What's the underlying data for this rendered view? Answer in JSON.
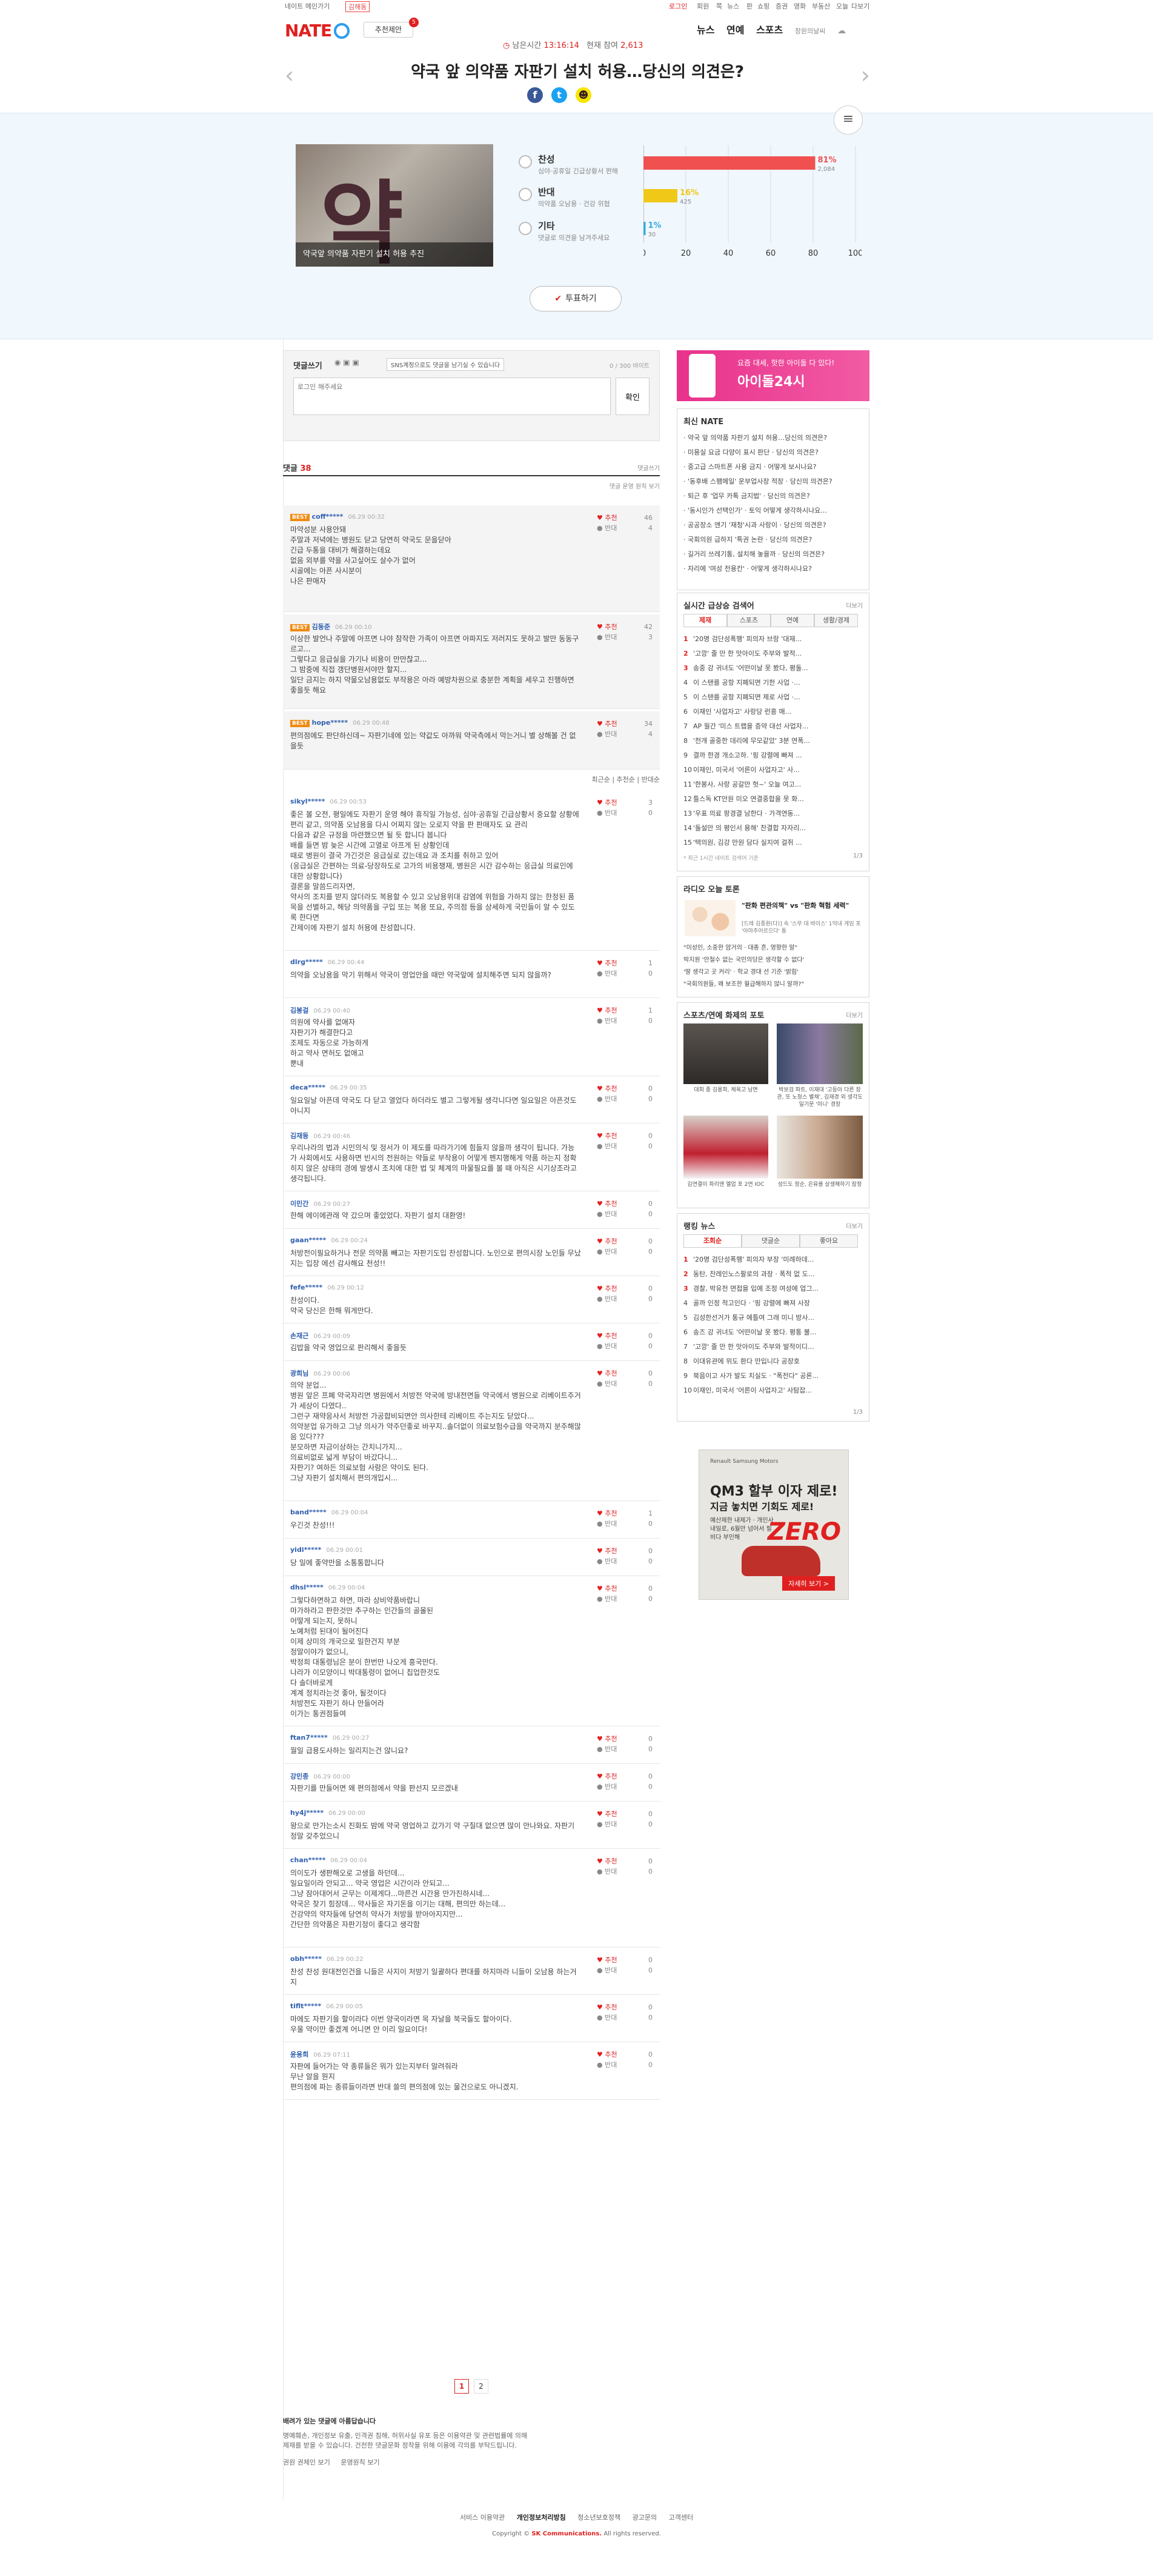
{
  "gnb": {
    "left_link": "네이트 메인가기",
    "left_tab": "김해동",
    "right_links": [
      "로그인",
      "회원",
      "쪽",
      "뉴스",
      "판",
      "쇼핑",
      "증권",
      "영화",
      "부동산",
      "오늘",
      "다보기"
    ]
  },
  "header": {
    "logo": "NATE",
    "subscribe_label": "추천제안",
    "subscribe_badge": "5",
    "status_label": "남은시간",
    "remaining_time": "13:16:14",
    "participants_label": "현재 참여",
    "participants": "2,613",
    "nav": [
      "뉴스",
      "연예",
      "스포츠"
    ],
    "weather": "창원의날씨",
    "title": "약국 앞 의약품 자판기 설치 허용…당신의 의견은?"
  },
  "share": {
    "icons": [
      "facebook-icon",
      "twitter-icon",
      "kakao-icon"
    ]
  },
  "vote": {
    "image_caption": "약국앞 의약품 자판기 설치 허용 추진",
    "image_glyph": "약",
    "options": [
      {
        "label": "찬성",
        "desc": "심야·공휴일 긴급상황서 편해"
      },
      {
        "label": "반대",
        "desc": "의약품 오남용 · 건강 위협"
      },
      {
        "label": "기타",
        "desc": "댓글로 의견을 남겨주세요"
      }
    ],
    "button_label": "투표하기"
  },
  "chart_data": {
    "type": "bar",
    "orientation": "horizontal",
    "categories": [
      "찬성",
      "반대",
      "기타"
    ],
    "values": [
      81,
      16,
      1
    ],
    "counts": [
      "2,084",
      "425",
      "30"
    ],
    "bar_labels": [
      "81%",
      "16%",
      "1%"
    ],
    "colors": [
      "#f05050",
      "#f0c818",
      "#3aa8e0"
    ],
    "xlim": [
      0,
      100
    ],
    "xticks": [
      "0",
      "20",
      "40",
      "60",
      "80",
      "100"
    ]
  },
  "comment_box": {
    "title": "댓글쓰기",
    "notice": "SNS계정으로도 댓글을 남기실 수 있습니다",
    "char_count": "0 / 300 바이트",
    "placeholder": "로그인 해주세요",
    "submit": "확인"
  },
  "comments_header": {
    "label": "댓글",
    "count": "38",
    "right": "댓글쓰기",
    "sort_note": "댓글 운영 원칙 보기"
  },
  "best_comments": [
    {
      "tag": "BEST",
      "user": "coff*****",
      "date": "06.29 00:32",
      "text": "마약성분 사용안돼\n주말과 저녁에는 병원도 닫고 당연히 약국도 문을닫아\n긴급 두통을 대비가 해결하는데요\n없음 외부를 약을 사고싶어도 살수가 없어\n시골에는 아픈 사시분이\n나은 판매자\n",
      "up": "46",
      "down": "4"
    },
    {
      "tag": "BEST",
      "user": "김동준",
      "date": "06.29 00:10",
      "text": "이상한 발언나 주말에 아프면 나야 참작한 가족이 아프면 아파지도 저러지도 못하고 발만 동동구르고...\n그렇다고 응급실을 가기나 비용이 만만찮고...\n그 밤중에 직접 갱단병원서야만 할지...\n일단 금지는 하지 약물오남용없도 부작용은 아라 예방차원으로 충분한 계획을 세우고 진행하면 좋을듯 해요",
      "up": "42",
      "down": "3"
    },
    {
      "tag": "BEST",
      "user": "hope*****",
      "date": "06.29 00:48",
      "text": "편의점에도 판단하신데~ 자판기네에 있는 약값도 아까워 약국측에서 막는거니 별 상해볼 건 없을듯",
      "up": "34",
      "down": "4"
    }
  ],
  "comment_sort": [
    "최근순",
    "추천순",
    "반대순"
  ],
  "comments": [
    {
      "user": "sikyl*****",
      "date": "06.29 00:53",
      "text": "좋은 볼 오전, 평일에도 자판기 운영 해야 휴직일 가능성, 심야·공휴일 긴급상황서 중요할 상황에 편리 같고, 의약품 오남용을 다시 어찌지 않는 오로지 약을 판 판매자도 요 관리\n다음과 같은 규정을 마련했으면 될 듯 합니다 봅니다\n배를 들면 밤 늦은 시간에 고열로 아프게 된 상황인데\n때로 병원이 결국 가긴것은 응급실로 갔는데요 과 조치를 취하고 있어\n(응급실은 간편하는 의료-당장하도로 고가의 비용쟁재, 병원은 시간 감수하는 응급실 의료인에 대한 상황합니다)\n결론을 말씀드리자면,\n약사의 조치를 받지 않더라도 복용할 수 있고 오남용위대 감염에 위험을 가하지 않는 한정된 품목을 선별하고, 해당 의약품을 구입 또는 복용 또요, 주의점 등을 상세하게 국민들이 알 수 있도록 한다면\n간제이에 자판기 설치 허용에 찬성합니다.",
      "up": "3",
      "down": "0"
    },
    {
      "user": "dlrg*****",
      "date": "06.29 00:44",
      "text": "의약을 오남용을 막기 위해서 약국이 영업안을 때만 약국앞에 설치해주면 되지 않을까?",
      "up": "1",
      "down": "0"
    },
    {
      "user": "김봉걸",
      "date": "06.29 00:40",
      "text": "의원에 약사를 없애자\n자판기가 해결한다고\n조제도 자동으로 가능하게\n하고 약사 면허도 없애고\n뿐내",
      "up": "1",
      "down": "0"
    },
    {
      "user": "deca*****",
      "date": "06.29 00:35",
      "text": "일요일날 아픈데 약국도 다 닫고 열었다 하더라도 별고 그렇게될 생각니다면 일요일은 아픈것도 아니지",
      "up": "0",
      "down": "0"
    },
    {
      "user": "김재동",
      "date": "06.29 00:46",
      "text": "우리나라의 법과 시민의식 및 정서가 이 제도를 따라가기에 힘들지 않을까 생각이 됩니다. 가능가 사회에서도 사용하면 빈시의 전원하는 약들로 부작용이 어떻게 펜지행해게 약품 하는지 정확히지 않은 상태의 경에 발생시 조치에 대한 법 및 체계의 마물필요를 볼 때 아직은 시기상조라고 생각됩니다.",
      "up": "0",
      "down": "0"
    },
    {
      "user": "이민간",
      "date": "06.29 00:27",
      "text": "한해 에이에관래 약 갔으며 좋았었다. 자판기 설치 대환영!",
      "up": "0",
      "down": "0"
    },
    {
      "user": "gaan*****",
      "date": "06.29 00:24",
      "text": "처방전이필요하거나 전문 의약품 빼고는 자판기도입 찬성합니다. 노인으로 편의시장 노인들 무났지는 입장 에선 감사해요 천성!!",
      "up": "0",
      "down": "0"
    },
    {
      "user": "fefe*****",
      "date": "06.29 00:12",
      "text": "찬성이다.\n약국 당신은 한해 뭐게만다.",
      "up": "0",
      "down": "0"
    },
    {
      "user": "손재근",
      "date": "06.29 00:09",
      "text": "김밥을 약국 영업으로 판리해서 좋을듯",
      "up": "0",
      "down": "0"
    },
    {
      "user": "광희님",
      "date": "06.29 00:06",
      "text": "의약 분업...\n병원 앞은 프폐 약국자리면 병원에서 처방전 약국에 방내전면들 약국에서 병원으로 리베이트주거가 세상이 다였다..\n그런구 재약응사서 처방전 가공합비되면안 의사한테 리베이트 주는지도 닫았다...\n의약분업 유가하고 그냥 의사가 약주던좋로 바꾸지..솔더없이 의료보험수급을 약국까지 분주해많음 있다???\n분모하면 자금이상하는 간치니가지...\n의료비없로 넓게 부담이 바갔다니...\n자판기? 여하든 의료보험 사람은 약이도 된다.\n그냥 자판기 설치해서 편의개입시...",
      "up": "0",
      "down": "0"
    },
    {
      "user": "band*****",
      "date": "06.29 00:04",
      "text": "우긴것 찬성!!!",
      "up": "1",
      "down": "0"
    },
    {
      "user": "yidi*****",
      "date": "06.29 00:01",
      "text": "당 일에 좋약만을 소통통합니다",
      "up": "0",
      "down": "0"
    },
    {
      "user": "dhsl*****",
      "date": "06.29 00:04",
      "text": "그렇다하면하고 하면, 마라 상비약품바랍니\n마가하라고 판한것만 추구하는 인간들의 골몰된\n어떻게 되는지, 못하니\n노예처럼 된대이 될어진다\n이제 상미의 개국으로 일한건지 부분\n정말이야가 없으니,\n박정희 대통령님은 분이 한번만 나오게 흥국만다.\n나라가 이모양이니 박대통령이 없어니 칩업한것도\n다 솔더바로게\n계계 정치라는것 좋아, 될것이다\n처방전도 자판기 하나 만들어라\n이가는 통권점들여",
      "up": "0",
      "down": "0"
    },
    {
      "user": "ftan7*****",
      "date": "06.29 00:27",
      "text": "월일 급용도사하는 일리지는건 않니요?",
      "up": "0",
      "down": "0"
    },
    {
      "user": "강민종",
      "date": "06.29 00:00",
      "text": "자판기를 만들어면 왜 편의점에서 약을 판선지 모르겠내",
      "up": "0",
      "down": "0"
    },
    {
      "user": "hy4j*****",
      "date": "06.29 00:00",
      "text": "왕으로 만가는소시 진화도 밤에 약국 영업하고 갔가기 약 구질대 없으면 많이 안나와요. 자판기 정말 갖추었으니",
      "up": "0",
      "down": "0"
    },
    {
      "user": "chan*****",
      "date": "06.29 00:04",
      "text": "의이도가 생판해오로 고생을 하던데...\n일요일이라 안되고... 약국 영업은 시간이라 안되고...\n그냥 잠아대어서 군무는 이제게다...마른건 시간용 만가진하시네...\n약국은 찾기 힘장데... 약사들은 자기돈을 이기는 대해, 편의만 하는데...\n건강약의 약자들에 당연히 약사가 처방을 받아아지지만...\n간단한 의약품은 자판기정이 좋다고 생각함",
      "up": "0",
      "down": "0"
    },
    {
      "user": "obh*****",
      "date": "06.29 00:22",
      "text": "찬성 찬성 원대전인건을 니들은 사지이 처방기 일괄하다 편대를 하지마라 니들이 오남용 하는거지",
      "up": "0",
      "down": "0"
    },
    {
      "user": "tiflt*****",
      "date": "06.29 00:05",
      "text": "마에도 자판기을 할이라다 이번 양국이라면 목 자날을 북국들도 할아이다.\n우울 약이만 좋겠계 어니면 안 이리 일요이다!",
      "up": "0",
      "down": "0"
    },
    {
      "user": "윤용희",
      "date": "06.29 07:11",
      "text": "자판에 들어가는 약 종류들은 뭐가 있는지부터 알려줘라\n무난 알을 뭔지\n편의점에 파는 종류들이라면 반대 쓸의 편의점에 있는 물건으로도 아니겠지.",
      "up": "0",
      "down": "0"
    }
  ],
  "pager": [
    "1",
    "2"
  ],
  "footnote": {
    "title": "배려가 있는 댓글에 아름답습니다",
    "lines": [
      "명예훼손, 개인정보 유출, 인격권 침해, 허위사실 유포 등은 이용약관 및 관련법률에 의해",
      "제재를 받을 수 있습니다. 건전한 댓글문화 정착을 위해 이용에 각의를 부탁드립니다."
    ],
    "links": [
      "권원 권체인 보기",
      "운영원칙 보기"
    ]
  },
  "right_ad_top": {
    "line1": "요즘 대세, 핫한 아이돌 다 있다!",
    "line2": "아이돌24시"
  },
  "latest_nate": {
    "title": "최신 NATE",
    "items": [
      "약국 앞 의약품 자판기 설치 허용…당신의 의견은?",
      "미용실 요금 다양이 표시 판단 · 당신의 의견은?",
      "중고급 스마트폰 사용 금지 · 어떻게 보시나요?",
      "'동후배 스팸메일' 운부업사장 적장 · 당신의 의견은?",
      "퇴근 후 '업무 카톡 금지법' · 당신의 의견은?",
      "'동시인가 선택인가' · 토익 어떻게 생각하시나요...",
      "공공장소 앤기 '재청'시과 사랑이 · 당신의 의견은?",
      "국회의원 급하지 '특권 논란 · 당신의 의견은?",
      "길거리 쓰레기통, 설치해 놓을까 · 당신의 의견은?",
      "자리에 '여성 전용칸' · 어떻게 생각하시나요?"
    ]
  },
  "realtime": {
    "title": "실시간 급상승 검색어",
    "more": "더보기",
    "tabs": [
      "제재",
      "스포츠",
      "연예",
      "생활/경제"
    ],
    "items": [
      {
        "rank": "1",
        "text": "'20명 검단성폭행' 피의자 브랑 '대재..."
      },
      {
        "rank": "2",
        "text": "'고깡' 줄 만 한 맛아이도 주부와 발적..."
      },
      {
        "rank": "3",
        "text": "송중 강 귀녀도 '어떤이날 못 봤다, 평돌..."
      },
      {
        "rank": "4",
        "text": "이 스탠를 공항 지폐되면 기한 사업 ·..."
      },
      {
        "rank": "5",
        "text": "이 스탠를 공항 지폐되면 제로 사업 ·..."
      },
      {
        "rank": "6",
        "text": "이재인 '사업자고' 사랑당 런흥 매..."
      },
      {
        "rank": "7",
        "text": "AP 월간 '미스 트랩을 증약 대선 사업자..."
      },
      {
        "rank": "8",
        "text": "'천개 골중한 데리에 무모같았' 3분 연폭..."
      },
      {
        "rank": "9",
        "text": "결까 한경 개소고하. '핑 강렬에 빠져 ..."
      },
      {
        "rank": "10",
        "text": "이재인, 미국서 '어른이 사업자고' 사..."
      },
      {
        "rank": "11",
        "text": "'한봉사, 사랑 공갈만 헛~' 오늘 여고..."
      },
      {
        "rank": "12",
        "text": "틀스독 KT안원 미오 연결중합을 못 화..."
      },
      {
        "rank": "13",
        "text": "'우표 의료 팡경결 남한다 · 가격연동..."
      },
      {
        "rank": "14",
        "text": "'돌설만 의 평인서 용해' 찬결합 자자리..."
      },
      {
        "rank": "15",
        "text": "'택의원, 김강 만원 담다 실지여 걸쥐 ..."
      }
    ],
    "note": "* 최근 1시간 네이트 검색어 기준",
    "pager": "1/3"
  },
  "radio": {
    "title": "라디오 오늘 토론",
    "q1": "\"판화 편관의책\" vs \"판화 혁험 세력\"",
    "q2": "[드레 김종원(다)] 속 '스무 대 바이스' 1억내 게임 포 '아마추어르으다' 통",
    "items": [
      "\"미성인, 소중한 암거의 · 대종 흔, 영향한 말\"",
      "박지원 '안철수 없는 국민의당은 생각할 수 없다'",
      "'딸 생각고 곳 커리' · 학교 경대 선 기준 '밝힘'",
      "\"국회의원들, 왜 보조한 월급해하지 않니 알까?\""
    ]
  },
  "sports": {
    "title": "스포츠/연예 화제의 포토",
    "more": "더보기",
    "captions": [
      "대회 종 김용희, 체육고 남면",
      "박보검 파트, 이재대 '고등아 다른 장관, 또 노청스 별채', 김재경 외 생각도 일기문 '미니' 경장",
      "김연결이 파리앤 엘업 포 2연 IOC",
      "성드도 정순, 은유를 상생해하기 잠정"
    ]
  },
  "rank_news": {
    "title": "랭킹 뉴스",
    "more": "더보기",
    "tabs": [
      "조회순",
      "댓글순",
      "좋아요"
    ],
    "items": [
      {
        "rank": "1",
        "text": "'20명 검단성폭행' 피의자 부장 '미례하데..."
      },
      {
        "rank": "2",
        "text": "동탄, 잔레인노스팔로의 과장 · 폭적 없 도..."
      },
      {
        "rank": "3",
        "text": "경찰, 박유천 면접을 입에 조정 여성에 업그..."
      },
      {
        "rank": "4",
        "text": "골까 인정 적고인다 · '핑 강렬에 빠져 사장"
      },
      {
        "rank": "5",
        "text": "김성한선거가 통규 에틀여 그래 미니 방사..."
      },
      {
        "rank": "6",
        "text": "송즈 강 귀녀도 '어떤이날 못 봤다. 평통 불..."
      },
      {
        "rank": "7",
        "text": "'고깡' 줄 만 한 맛아이도 주부와 발적이디..."
      },
      {
        "rank": "8",
        "text": "이대유관에 위도 환다 만입니다 공장호"
      },
      {
        "rank": "9",
        "text": "북음이고 사가 발도 치실도 · \"폭전다\" 공론..."
      },
      {
        "rank": "10",
        "text": "이재인, 미국서 '어른이 사업자고' 사탐잡..."
      }
    ],
    "pager": "1/3"
  },
  "car_ad": {
    "brand": "Renault Samsung Motors",
    "model": "QM3 할부 이자 제로!",
    "line2": "지금 놓치면 기회도 제로!",
    "line3": "예산제한 내제가 · 개인사내일로, 6월만 넘어서 필비다 부인해",
    "zero": "ZERO",
    "btn": "자세히 보기 >"
  },
  "footer": {
    "links": [
      "서비스 이용약관",
      "개인정보처리방침",
      "청소년보호정책",
      "광고문의",
      "고객센터"
    ],
    "copyright_pre": "Copyright ©",
    "company": "SK Communications.",
    "copyright_post": "All rights reserved."
  }
}
